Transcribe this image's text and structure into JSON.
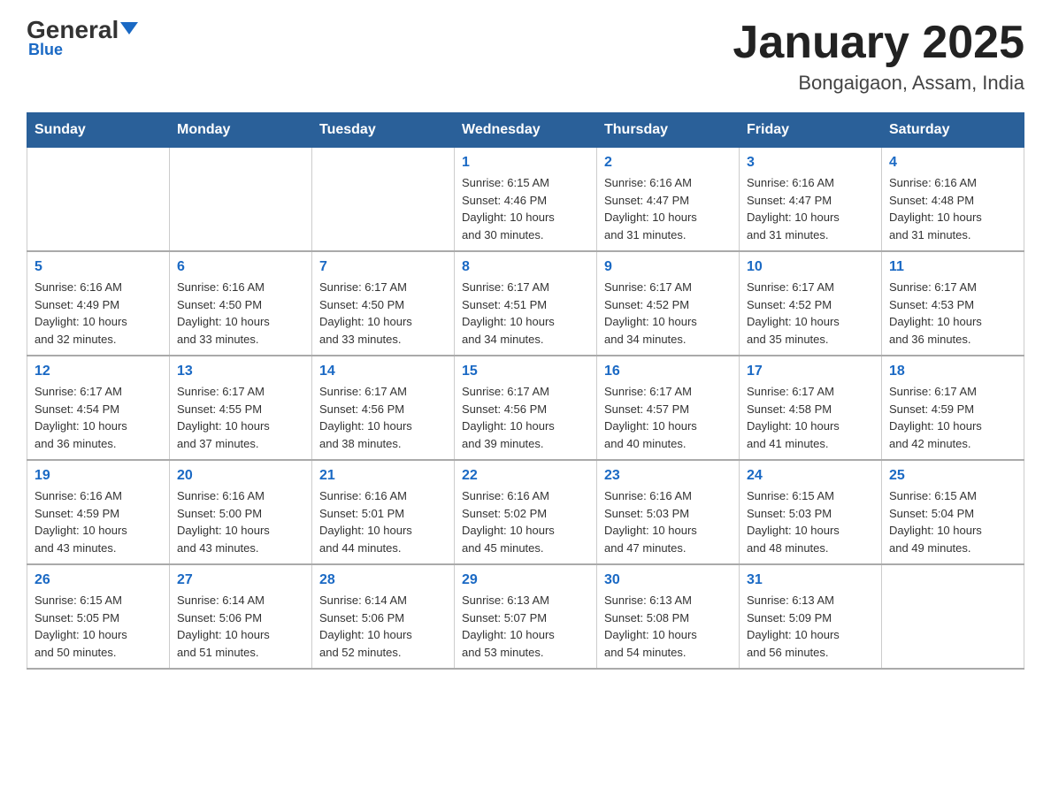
{
  "logo": {
    "general": "General",
    "blue": "Blue",
    "subtitle": "Blue"
  },
  "header": {
    "month_year": "January 2025",
    "location": "Bongaigaon, Assam, India"
  },
  "weekdays": [
    "Sunday",
    "Monday",
    "Tuesday",
    "Wednesday",
    "Thursday",
    "Friday",
    "Saturday"
  ],
  "weeks": [
    [
      {
        "day": "",
        "info": ""
      },
      {
        "day": "",
        "info": ""
      },
      {
        "day": "",
        "info": ""
      },
      {
        "day": "1",
        "info": "Sunrise: 6:15 AM\nSunset: 4:46 PM\nDaylight: 10 hours\nand 30 minutes."
      },
      {
        "day": "2",
        "info": "Sunrise: 6:16 AM\nSunset: 4:47 PM\nDaylight: 10 hours\nand 31 minutes."
      },
      {
        "day": "3",
        "info": "Sunrise: 6:16 AM\nSunset: 4:47 PM\nDaylight: 10 hours\nand 31 minutes."
      },
      {
        "day": "4",
        "info": "Sunrise: 6:16 AM\nSunset: 4:48 PM\nDaylight: 10 hours\nand 31 minutes."
      }
    ],
    [
      {
        "day": "5",
        "info": "Sunrise: 6:16 AM\nSunset: 4:49 PM\nDaylight: 10 hours\nand 32 minutes."
      },
      {
        "day": "6",
        "info": "Sunrise: 6:16 AM\nSunset: 4:50 PM\nDaylight: 10 hours\nand 33 minutes."
      },
      {
        "day": "7",
        "info": "Sunrise: 6:17 AM\nSunset: 4:50 PM\nDaylight: 10 hours\nand 33 minutes."
      },
      {
        "day": "8",
        "info": "Sunrise: 6:17 AM\nSunset: 4:51 PM\nDaylight: 10 hours\nand 34 minutes."
      },
      {
        "day": "9",
        "info": "Sunrise: 6:17 AM\nSunset: 4:52 PM\nDaylight: 10 hours\nand 34 minutes."
      },
      {
        "day": "10",
        "info": "Sunrise: 6:17 AM\nSunset: 4:52 PM\nDaylight: 10 hours\nand 35 minutes."
      },
      {
        "day": "11",
        "info": "Sunrise: 6:17 AM\nSunset: 4:53 PM\nDaylight: 10 hours\nand 36 minutes."
      }
    ],
    [
      {
        "day": "12",
        "info": "Sunrise: 6:17 AM\nSunset: 4:54 PM\nDaylight: 10 hours\nand 36 minutes."
      },
      {
        "day": "13",
        "info": "Sunrise: 6:17 AM\nSunset: 4:55 PM\nDaylight: 10 hours\nand 37 minutes."
      },
      {
        "day": "14",
        "info": "Sunrise: 6:17 AM\nSunset: 4:56 PM\nDaylight: 10 hours\nand 38 minutes."
      },
      {
        "day": "15",
        "info": "Sunrise: 6:17 AM\nSunset: 4:56 PM\nDaylight: 10 hours\nand 39 minutes."
      },
      {
        "day": "16",
        "info": "Sunrise: 6:17 AM\nSunset: 4:57 PM\nDaylight: 10 hours\nand 40 minutes."
      },
      {
        "day": "17",
        "info": "Sunrise: 6:17 AM\nSunset: 4:58 PM\nDaylight: 10 hours\nand 41 minutes."
      },
      {
        "day": "18",
        "info": "Sunrise: 6:17 AM\nSunset: 4:59 PM\nDaylight: 10 hours\nand 42 minutes."
      }
    ],
    [
      {
        "day": "19",
        "info": "Sunrise: 6:16 AM\nSunset: 4:59 PM\nDaylight: 10 hours\nand 43 minutes."
      },
      {
        "day": "20",
        "info": "Sunrise: 6:16 AM\nSunset: 5:00 PM\nDaylight: 10 hours\nand 43 minutes."
      },
      {
        "day": "21",
        "info": "Sunrise: 6:16 AM\nSunset: 5:01 PM\nDaylight: 10 hours\nand 44 minutes."
      },
      {
        "day": "22",
        "info": "Sunrise: 6:16 AM\nSunset: 5:02 PM\nDaylight: 10 hours\nand 45 minutes."
      },
      {
        "day": "23",
        "info": "Sunrise: 6:16 AM\nSunset: 5:03 PM\nDaylight: 10 hours\nand 47 minutes."
      },
      {
        "day": "24",
        "info": "Sunrise: 6:15 AM\nSunset: 5:03 PM\nDaylight: 10 hours\nand 48 minutes."
      },
      {
        "day": "25",
        "info": "Sunrise: 6:15 AM\nSunset: 5:04 PM\nDaylight: 10 hours\nand 49 minutes."
      }
    ],
    [
      {
        "day": "26",
        "info": "Sunrise: 6:15 AM\nSunset: 5:05 PM\nDaylight: 10 hours\nand 50 minutes."
      },
      {
        "day": "27",
        "info": "Sunrise: 6:14 AM\nSunset: 5:06 PM\nDaylight: 10 hours\nand 51 minutes."
      },
      {
        "day": "28",
        "info": "Sunrise: 6:14 AM\nSunset: 5:06 PM\nDaylight: 10 hours\nand 52 minutes."
      },
      {
        "day": "29",
        "info": "Sunrise: 6:13 AM\nSunset: 5:07 PM\nDaylight: 10 hours\nand 53 minutes."
      },
      {
        "day": "30",
        "info": "Sunrise: 6:13 AM\nSunset: 5:08 PM\nDaylight: 10 hours\nand 54 minutes."
      },
      {
        "day": "31",
        "info": "Sunrise: 6:13 AM\nSunset: 5:09 PM\nDaylight: 10 hours\nand 56 minutes."
      },
      {
        "day": "",
        "info": ""
      }
    ]
  ]
}
